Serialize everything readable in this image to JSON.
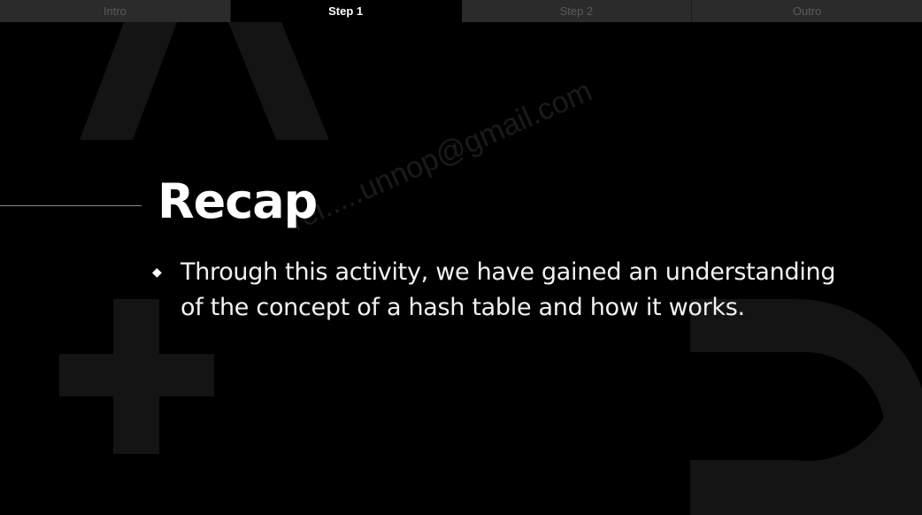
{
  "tabs": [
    {
      "label": "Intro",
      "active": false
    },
    {
      "label": "Step 1",
      "active": true
    },
    {
      "label": "Step 2",
      "active": false
    },
    {
      "label": "Outro",
      "active": false
    }
  ],
  "slide": {
    "title": "Recap",
    "bullet_marker": "◆",
    "bullets": [
      "Through this activity, we have gained an understanding of the concept of a hash table and how it works."
    ],
    "watermark": "rei.....unnop@gmail.com"
  },
  "colors": {
    "background": "#000000",
    "tab_inactive_bg": "#2b2b2b",
    "tab_active_bg": "#000000",
    "text": "#ffffff",
    "decor_shape": "#141414"
  }
}
